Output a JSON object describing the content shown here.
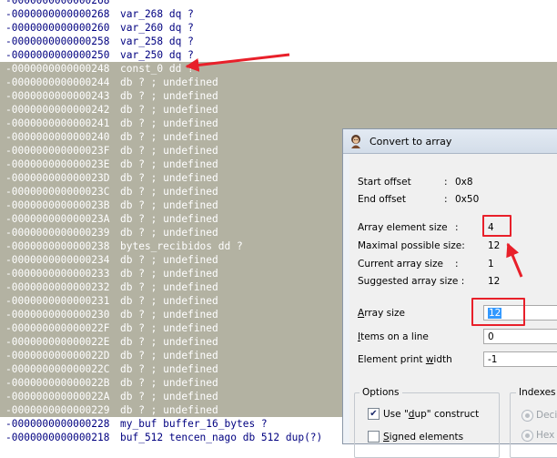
{
  "listing": {
    "lines": [
      {
        "addr": "-0000000000000268",
        "src": "",
        "sel": false
      },
      {
        "addr": "-0000000000000268",
        "src": "var_268 dq ?",
        "sel": false
      },
      {
        "addr": "-0000000000000260",
        "src": "var_260 dq ?",
        "sel": false
      },
      {
        "addr": "-0000000000000258",
        "src": "var_258 dq ?",
        "sel": false
      },
      {
        "addr": "-0000000000000250",
        "src": "var_250 dq ?",
        "sel": false
      },
      {
        "addr": "-0000000000000248",
        "src": "const_0 dd ?",
        "sel": true
      },
      {
        "addr": "-0000000000000244",
        "src": "db ? ; undefined",
        "sel": true
      },
      {
        "addr": "-0000000000000243",
        "src": "db ? ; undefined",
        "sel": true
      },
      {
        "addr": "-0000000000000242",
        "src": "db ? ; undefined",
        "sel": true
      },
      {
        "addr": "-0000000000000241",
        "src": "db ? ; undefined",
        "sel": true
      },
      {
        "addr": "-0000000000000240",
        "src": "db ? ; undefined",
        "sel": true
      },
      {
        "addr": "-000000000000023F",
        "src": "db ? ; undefined",
        "sel": true
      },
      {
        "addr": "-000000000000023E",
        "src": "db ? ; undefined",
        "sel": true
      },
      {
        "addr": "-000000000000023D",
        "src": "db ? ; undefined",
        "sel": true
      },
      {
        "addr": "-000000000000023C",
        "src": "db ? ; undefined",
        "sel": true
      },
      {
        "addr": "-000000000000023B",
        "src": "db ? ; undefined",
        "sel": true
      },
      {
        "addr": "-000000000000023A",
        "src": "db ? ; undefined",
        "sel": true
      },
      {
        "addr": "-0000000000000239",
        "src": "db ? ; undefined",
        "sel": true
      },
      {
        "addr": "-0000000000000238",
        "src": "bytes_recibidos dd ?",
        "sel": true
      },
      {
        "addr": "-0000000000000234",
        "src": "db ? ; undefined",
        "sel": true
      },
      {
        "addr": "-0000000000000233",
        "src": "db ? ; undefined",
        "sel": true
      },
      {
        "addr": "-0000000000000232",
        "src": "db ? ; undefined",
        "sel": true
      },
      {
        "addr": "-0000000000000231",
        "src": "db ? ; undefined",
        "sel": true
      },
      {
        "addr": "-0000000000000230",
        "src": "db ? ; undefined",
        "sel": true
      },
      {
        "addr": "-000000000000022F",
        "src": "db ? ; undefined",
        "sel": true
      },
      {
        "addr": "-000000000000022E",
        "src": "db ? ; undefined",
        "sel": true
      },
      {
        "addr": "-000000000000022D",
        "src": "db ? ; undefined",
        "sel": true
      },
      {
        "addr": "-000000000000022C",
        "src": "db ? ; undefined",
        "sel": true
      },
      {
        "addr": "-000000000000022B",
        "src": "db ? ; undefined",
        "sel": true
      },
      {
        "addr": "-000000000000022A",
        "src": "db ? ; undefined",
        "sel": true
      },
      {
        "addr": "-0000000000000229",
        "src": "db ? ; undefined",
        "sel": true
      },
      {
        "addr": "-0000000000000228",
        "src": "my_buf buffer_16_bytes ?",
        "sel": false
      },
      {
        "addr": "-0000000000000218",
        "src": "buf_512 tencen_nago db 512 dup(?)",
        "sel": false
      }
    ]
  },
  "dialog": {
    "title": "Convert to array",
    "start_offset_label": "Start offset",
    "start_offset_value": "0x8",
    "end_offset_label": "End offset",
    "end_offset_value": "0x50",
    "element_size_label": "Array element size",
    "element_size_value": "4",
    "max_size_label": "Maximal possible size:",
    "max_size_value": "12",
    "current_size_label": "Current array size",
    "current_size_value": "1",
    "suggested_size_label": "Suggested array size :",
    "suggested_size_value": "12",
    "colon": ":",
    "array_size_label_pre": "",
    "array_size_label_accel": "A",
    "array_size_label_post": "rray size",
    "array_size_value": "12",
    "items_label_accel": "I",
    "items_label_post": "tems on a line",
    "items_value": "0",
    "print_width_label_pre": "Element print ",
    "print_width_label_accel": "w",
    "print_width_label_post": "idth",
    "print_width_value": "-1",
    "options_label": "Options",
    "dup_label_pre": "Use \"",
    "dup_label_accel": "d",
    "dup_label_post": "up\" construct",
    "signed_label_pre": "",
    "signed_label_accel": "S",
    "signed_label_post": "igned elements",
    "indexes_label": "Indexes",
    "decimal_label": "Deci",
    "hex_label": "Hex",
    "check_glyph": "✔"
  },
  "colors": {
    "selection_bg": "#b3b2a2",
    "listing_text": "#000080",
    "annotation_red": "#e8202a"
  }
}
